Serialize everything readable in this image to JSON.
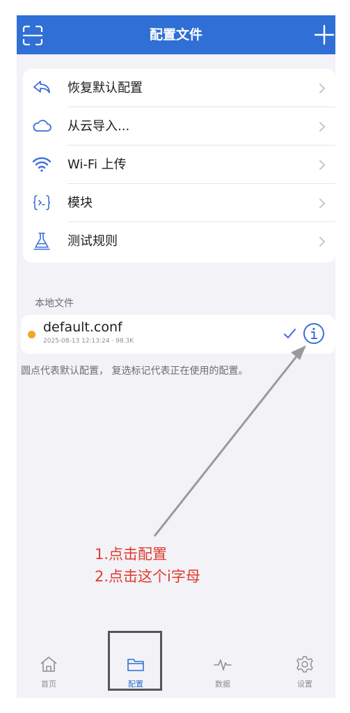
{
  "navbar": {
    "title": "配置文件"
  },
  "menu": {
    "items": [
      {
        "label": "恢复默认配置",
        "icon": "restore-icon"
      },
      {
        "label": "从云导入...",
        "icon": "cloud-icon"
      },
      {
        "label": "Wi-Fi 上传",
        "icon": "wifi-icon"
      },
      {
        "label": "模块",
        "icon": "module-icon"
      },
      {
        "label": "测试规则",
        "icon": "flask-icon"
      }
    ]
  },
  "local": {
    "header": "本地文件",
    "file": {
      "name": "default.conf",
      "meta": "2025-08-13 12:13:24 · 98.3K"
    },
    "footnote": "圆点代表默认配置， 复选标记代表正在使用的配置。"
  },
  "annotation": {
    "line1": "1.点击配置",
    "line2": "2.点击这个i字母"
  },
  "tabs": [
    {
      "label": "首页",
      "icon": "home-icon"
    },
    {
      "label": "配置",
      "icon": "folder-icon"
    },
    {
      "label": "数据",
      "icon": "activity-icon"
    },
    {
      "label": "设置",
      "icon": "gear-icon"
    }
  ],
  "colors": {
    "accent": "#2f6fd6",
    "annotation": "#e23b2e",
    "default_dot": "#f5a623"
  }
}
